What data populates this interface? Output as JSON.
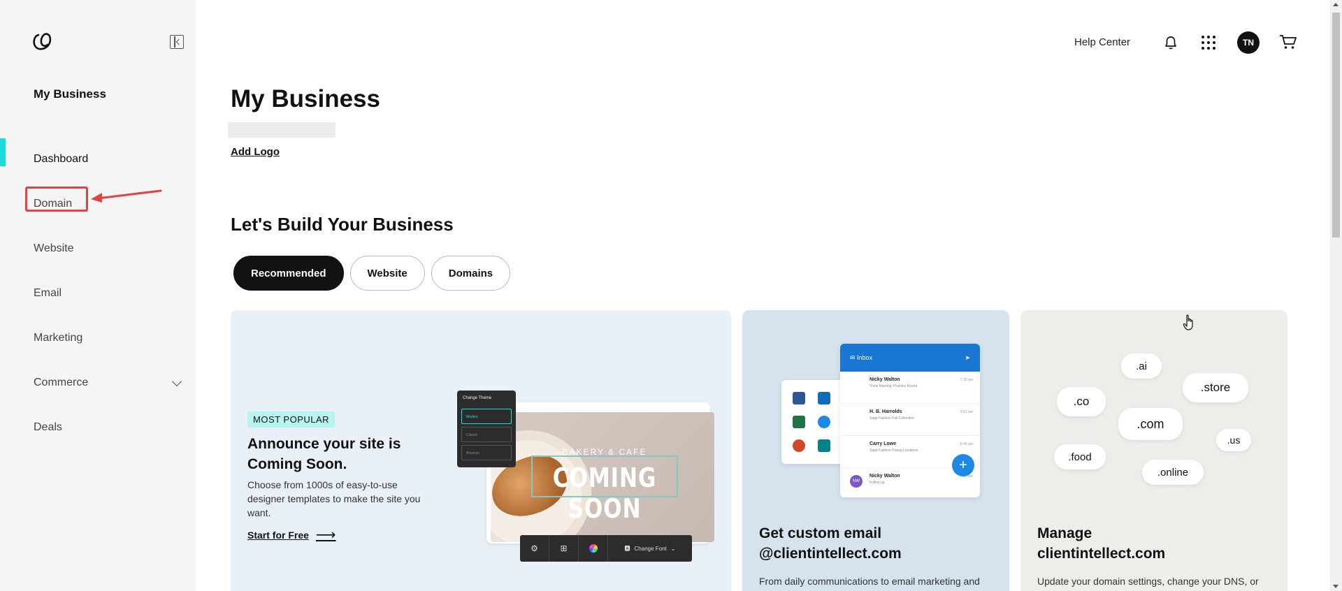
{
  "sidebar": {
    "title": "My Business",
    "items": [
      {
        "label": "Dashboard"
      },
      {
        "label": "Domain"
      },
      {
        "label": "Website"
      },
      {
        "label": "Email"
      },
      {
        "label": "Marketing"
      },
      {
        "label": "Commerce"
      },
      {
        "label": "Deals"
      }
    ]
  },
  "header": {
    "help": "Help Center",
    "avatar": "TN"
  },
  "main": {
    "title": "My Business",
    "add_logo": "Add Logo",
    "section_title": "Let's Build Your Business",
    "tabs": [
      {
        "label": "Recommended"
      },
      {
        "label": "Website"
      },
      {
        "label": "Domains"
      }
    ]
  },
  "cards": {
    "site": {
      "badge": "MOST POPULAR",
      "title": "Announce your site is Coming Soon.",
      "desc": "Choose from 1000s of easy-to-use designer templates to make the site you want.",
      "link": "Start for Free",
      "mock": {
        "theme_title": "Change Theme",
        "theme_options": [
          "Modern",
          "Classic",
          "Blossom"
        ],
        "bakery": "BAKERY & CAFE",
        "coming": "COMING SOON",
        "font_btn": "Change Font"
      }
    },
    "email": {
      "title_line1": "Get custom email",
      "title_line2": "@clientintellect.com",
      "desc": "From daily communications to email marketing and",
      "inbox_title": "Inbox",
      "mails": [
        {
          "name": "Nicky Walton",
          "subject": "Think Meeting: Practice Round",
          "time": "7:30 am"
        },
        {
          "name": "H. B. Harrolds",
          "subject": "Sage Fashion Fall Collection",
          "time": "9:51 am"
        },
        {
          "name": "Carry Lowe",
          "subject": "Sage Fashion Popup Locations",
          "time": "8:46 am"
        },
        {
          "name": "Nicky Walton",
          "subject": "Follow up",
          "time": "7:10 am"
        }
      ],
      "avatar_initials": "NW"
    },
    "domain": {
      "title_line1": "Manage",
      "title_line2": "clientintellect.com",
      "desc": "Update your domain settings, change your DNS, or",
      "tlds": [
        ".ai",
        ".store",
        ".co",
        ".com",
        ".us",
        ".food",
        ".online"
      ]
    }
  },
  "colors": {
    "accent": "#1bdbdb",
    "highlight": "#e04343",
    "badge": "#b6f5f1",
    "email_blue": "#1976d2"
  }
}
